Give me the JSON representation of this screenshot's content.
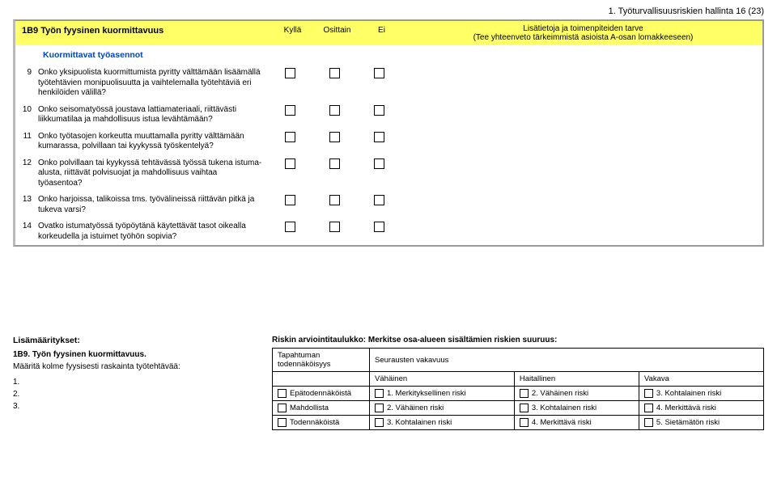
{
  "page_header": "1. Työturvallisuusriskien hallinta 16 (23)",
  "section": {
    "code_title": "1B9 Työn fyysinen kuormittavuus",
    "col_yes": "Kyllä",
    "col_partial": "Osittain",
    "col_no": "Ei",
    "col_notes_line1": "Lisätietoja ja toimenpiteiden tarve",
    "col_notes_line2": "(Tee yhteenveto tärkeimmistä asioista A-osan lomakkeeseen)",
    "subheader": "Kuormittavat työasennot"
  },
  "items": [
    {
      "n": "9",
      "t": "Onko yksipuolista kuormittumista pyritty välttämään lisäämällä työtehtävien monipuolisuutta ja vaihtelemalla työtehtäviä eri henkilöiden välillä?"
    },
    {
      "n": "10",
      "t": "Onko seisomatyössä joustava lattiamateriaali, riittävästi liikkumatilaa ja mahdollisuus istua levähtämään?"
    },
    {
      "n": "11",
      "t": "Onko työtasojen korkeutta muuttamalla pyritty välttämään kumarassa, polvillaan tai kyykyssä työskentelyä?"
    },
    {
      "n": "12",
      "t": "Onko polvillaan tai kyykyssä tehtävässä työssä tukena istuma-alusta, riittävät polvisuojat ja mahdollisuus vaihtaa työasentoa?"
    },
    {
      "n": "13",
      "t": "Onko harjoissa, talikoissa tms. työvälineissä riittävän pitkä ja tukeva varsi?"
    },
    {
      "n": "14",
      "t": "Ovatko istumatyössä työpöytänä käytettävät tasot oikealla korkeudella ja istuimet työhön sopivia?"
    }
  ],
  "specs": {
    "heading": "Lisämääritykset:",
    "sub": "1B9. Työn fyysinen kuormittavuus.",
    "desc": "Määritä kolme fyysisesti raskainta työtehtävää:",
    "lines": [
      "1.",
      "2.",
      "3."
    ]
  },
  "risk": {
    "title": "Riskin arviointitaulukko: Merkitse osa-alueen sisältämien riskien suuruus:",
    "col_prob": "Tapahtuman todennäköisyys",
    "col_sev": "Seurausten vakavuus",
    "sev1": "Vähäinen",
    "sev2": "Haitallinen",
    "sev3": "Vakava",
    "rows": [
      {
        "p": "Epätodennäköistä",
        "c1": "1. Merkityksellinen riski",
        "c2": "2. Vähäinen riski",
        "c3": "3. Kohtalainen riski"
      },
      {
        "p": "Mahdollista",
        "c1": "2. Vähäinen riski",
        "c2": "3. Kohtalainen riski",
        "c3": "4. Merkittävä riski"
      },
      {
        "p": "Todennäköistä",
        "c1": "3. Kohtalainen riski",
        "c2": "4. Merkittävä riski",
        "c3": "5. Sietämätön riski"
      }
    ]
  }
}
